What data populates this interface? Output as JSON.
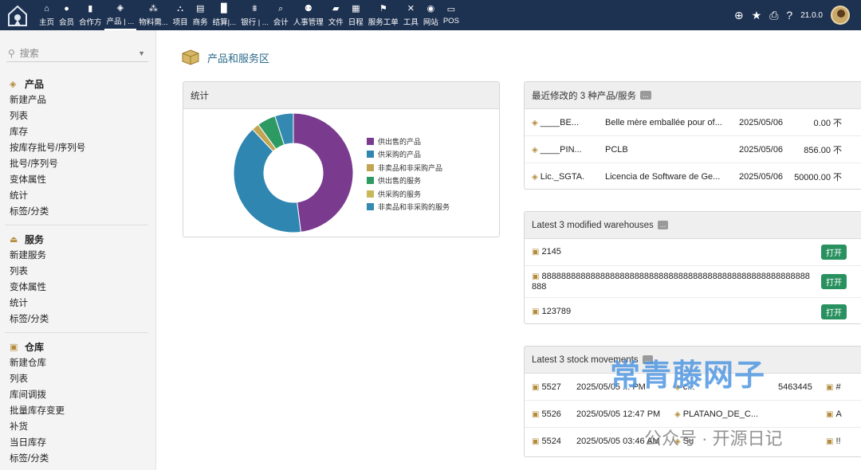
{
  "topbar": {
    "nav": [
      {
        "icon": "home-icon",
        "glyph": "⌂",
        "label": "主页"
      },
      {
        "icon": "user-icon",
        "glyph": "●",
        "label": "会员"
      },
      {
        "icon": "building-icon",
        "glyph": "▮",
        "label": "合作方"
      },
      {
        "icon": "cube-icon",
        "glyph": "◈",
        "label": "产品 | ..."
      },
      {
        "icon": "cubes-icon",
        "glyph": "⁂",
        "label": "物料需..."
      },
      {
        "icon": "project-icon",
        "glyph": "⛬",
        "label": "项目"
      },
      {
        "icon": "shop-icon",
        "glyph": "▤",
        "label": "商务"
      },
      {
        "icon": "invoice-icon",
        "glyph": "▉",
        "label": "结算|..."
      },
      {
        "icon": "bank-icon",
        "glyph": "⩩",
        "label": "银行 | ..."
      },
      {
        "icon": "accounting-icon",
        "glyph": "⌕",
        "label": "会计"
      },
      {
        "icon": "users-icon",
        "glyph": "⚉",
        "label": "人事管理"
      },
      {
        "icon": "folder-icon",
        "glyph": "▰",
        "label": "文件"
      },
      {
        "icon": "calendar-icon",
        "glyph": "▦",
        "label": "日程"
      },
      {
        "icon": "ticket-icon",
        "glyph": "⚑",
        "label": "服务工单"
      },
      {
        "icon": "tools-icon",
        "glyph": "✕",
        "label": "工具"
      },
      {
        "icon": "globe-icon",
        "glyph": "◉",
        "label": "网站"
      },
      {
        "icon": "pos-icon",
        "glyph": "▭",
        "label": "POS"
      }
    ],
    "version": "21.0.0"
  },
  "sidebar": {
    "search_placeholder": "搜索",
    "sections": [
      {
        "icon": "cube-icon",
        "title": "产品",
        "items": [
          "新建产品",
          "列表",
          "库存",
          "按库存批号/序列号",
          "批号/序列号",
          "变体属性",
          "统计",
          "标签/分类"
        ]
      },
      {
        "icon": "service-bell-icon",
        "title": "服务",
        "items": [
          "新建服务",
          "列表",
          "变体属性",
          "统计",
          "标签/分类"
        ]
      },
      {
        "icon": "warehouse-icon",
        "title": "仓库",
        "items": [
          "新建仓库",
          "列表",
          "库间调拨",
          "批量库存变更",
          "补货",
          "当日库存",
          "标签/分类"
        ]
      }
    ]
  },
  "main": {
    "title": "产品和服务区",
    "stats": {
      "title": "统计"
    },
    "products": {
      "title": "最近修改的 3 种产品/服务",
      "more": "...",
      "rows": [
        {
          "ref": "____BE...",
          "label": "Belle mère emballée pour of...",
          "date": "2025/05/06",
          "price": "0.00 不"
        },
        {
          "ref": "____PIN...",
          "label": "PCLB",
          "date": "2025/05/06",
          "price": "856.00 不"
        },
        {
          "ref": "Lic._SGTA.",
          "label": "Licencia de Software de Ge...",
          "date": "2025/05/06",
          "price": "50000.00 不"
        }
      ]
    },
    "warehouses": {
      "title": "Latest 3 modified warehouses",
      "more": "...",
      "rows": [
        {
          "name": "2145",
          "status": "打开"
        },
        {
          "name": "8888888888888888888888888888888888888888888888888888888888",
          "status": "打开"
        },
        {
          "name": "123789",
          "status": "打开"
        }
      ]
    },
    "movements": {
      "title": "Latest 3 stock movements",
      "more": "...",
      "rows": [
        {
          "id": "5527",
          "date": "2025/05/05 ... PM",
          "product": "c...",
          "qty": "5463445",
          "extra": "#"
        },
        {
          "id": "5526",
          "date": "2025/05/05 12:47 PM",
          "product": "PLATANO_DE_C...",
          "qty": "",
          "extra": "A"
        },
        {
          "id": "5524",
          "date": "2025/05/05 03:46 AM",
          "product": "Su",
          "qty": "",
          "extra": "!!"
        }
      ]
    }
  },
  "watermark": {
    "title": "常青藤网子",
    "subtitle": "公众号 · 开源日记"
  },
  "chart_data": {
    "type": "pie",
    "categories": [
      "供出售的产品",
      "供采购的产品",
      "非卖品和非采购产品",
      "供出售的服务",
      "供采购的服务",
      "非卖品和非采购的服务"
    ],
    "values": [
      48,
      40,
      2,
      5,
      0,
      5
    ],
    "colors": [
      "#7a3b8f",
      "#2f86b1",
      "#c2a552",
      "#2e9a63",
      "#c9b85a",
      "#3389b2"
    ],
    "title": "",
    "legend": "right",
    "donut": true
  }
}
